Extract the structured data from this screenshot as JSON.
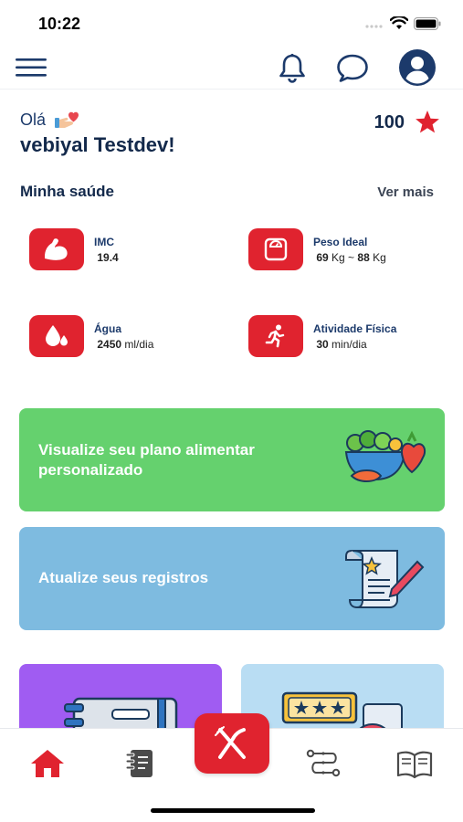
{
  "status_bar": {
    "time": "10:22"
  },
  "greeting": {
    "hello": "Olá",
    "name": "vebiyal Testdev!",
    "points": "100"
  },
  "health": {
    "title": "Minha saúde",
    "see_more": "Ver mais",
    "metrics": [
      {
        "label": "IMC",
        "value": "19.4",
        "unit": ""
      },
      {
        "label": "Peso Ideal",
        "value_a": "69",
        "unit_a": "Kg ~",
        "value_b": "88",
        "unit_b": "Kg"
      },
      {
        "label": "Água",
        "value": "2450",
        "unit": "ml/dia"
      },
      {
        "label": "Atividade Física",
        "value": "30",
        "unit": "min/dia"
      }
    ]
  },
  "banners": [
    {
      "line1": "Visualize seu plano alimentar",
      "line2": "personalizado",
      "icon": "salad-illustration"
    },
    {
      "line1": "Atualize seus registros",
      "icon": "certificate-illustration"
    }
  ],
  "colors": {
    "accent_red": "#e0232f",
    "navy": "#1c3a6b",
    "green_banner": "#65d16e",
    "blue_banner": "#7ebbe0",
    "purple_card": "#a05cf2",
    "light_blue_card": "#b9ddf3"
  },
  "bottom_nav": [
    {
      "icon": "home-icon",
      "active": true
    },
    {
      "icon": "notebook-icon"
    },
    {
      "icon": "fork-knife-icon",
      "center": true
    },
    {
      "icon": "path-icon"
    },
    {
      "icon": "book-icon"
    }
  ]
}
